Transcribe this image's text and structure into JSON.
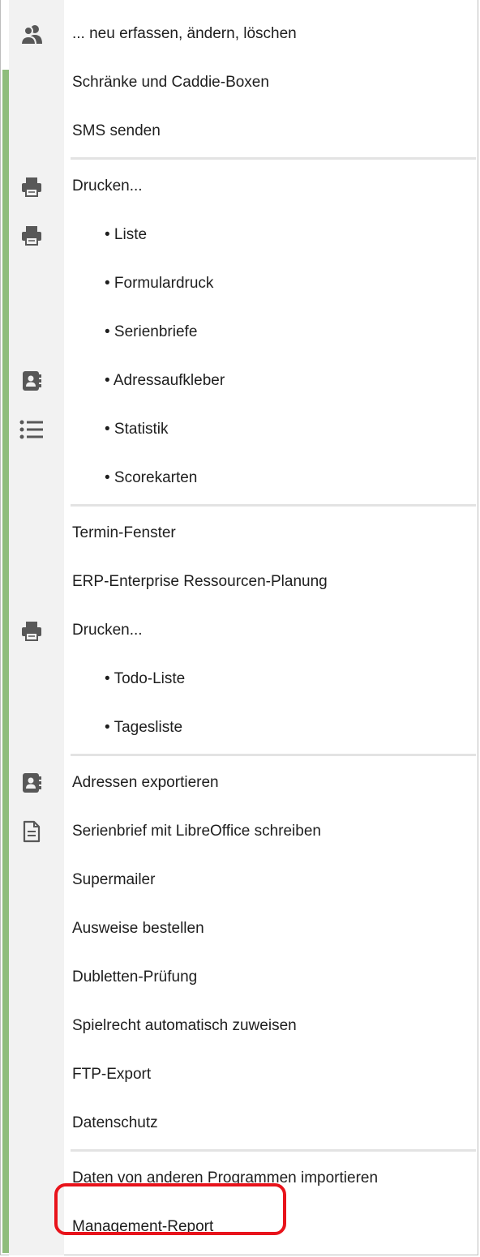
{
  "menu": {
    "items": [
      {
        "label": "... neu erfassen, ändern, löschen",
        "icon": "user-group-icon",
        "indent": false
      },
      {
        "label": "Schränke und Caddie-Boxen",
        "icon": null,
        "indent": false
      },
      {
        "label": "SMS senden",
        "icon": null,
        "indent": false
      },
      {
        "label": "Drucken...",
        "icon": "printer-icon",
        "indent": false
      },
      {
        "label": "• Liste",
        "icon": "printer-icon",
        "indent": true
      },
      {
        "label": "• Formulardruck",
        "icon": null,
        "indent": true
      },
      {
        "label": "• Serienbriefe",
        "icon": null,
        "indent": true
      },
      {
        "label": "• Adressaufkleber",
        "icon": "address-book-icon",
        "indent": true
      },
      {
        "label": "• Statistik",
        "icon": "list-icon",
        "indent": true
      },
      {
        "label": "• Scorekarten",
        "icon": null,
        "indent": true
      },
      {
        "label": "Termin-Fenster",
        "icon": null,
        "indent": false
      },
      {
        "label": "ERP-Enterprise Ressourcen-Planung",
        "icon": null,
        "indent": false
      },
      {
        "label": "Drucken...",
        "icon": "printer-icon",
        "indent": false
      },
      {
        "label": "• Todo-Liste",
        "icon": null,
        "indent": true
      },
      {
        "label": "• Tagesliste",
        "icon": null,
        "indent": true
      },
      {
        "label": "Adressen exportieren",
        "icon": "address-book-icon",
        "indent": false
      },
      {
        "label": "Serienbrief mit LibreOffice schreiben",
        "icon": "document-icon",
        "indent": false
      },
      {
        "label": "Supermailer",
        "icon": null,
        "indent": false
      },
      {
        "label": "Ausweise bestellen",
        "icon": null,
        "indent": false
      },
      {
        "label": "Dubletten-Prüfung",
        "icon": null,
        "indent": false
      },
      {
        "label": "Spielrecht automatisch zuweisen",
        "icon": null,
        "indent": false
      },
      {
        "label": "FTP-Export",
        "icon": null,
        "indent": false
      },
      {
        "label": "Datenschutz",
        "icon": null,
        "indent": false
      },
      {
        "label": "Daten von anderen Programmen importieren",
        "icon": null,
        "indent": false
      },
      {
        "label": "Management-Report",
        "icon": null,
        "indent": false
      }
    ],
    "highlighted_item": "Management-Report",
    "highlight_color": "#e8131b",
    "accent_color": "#8fbd7c"
  }
}
